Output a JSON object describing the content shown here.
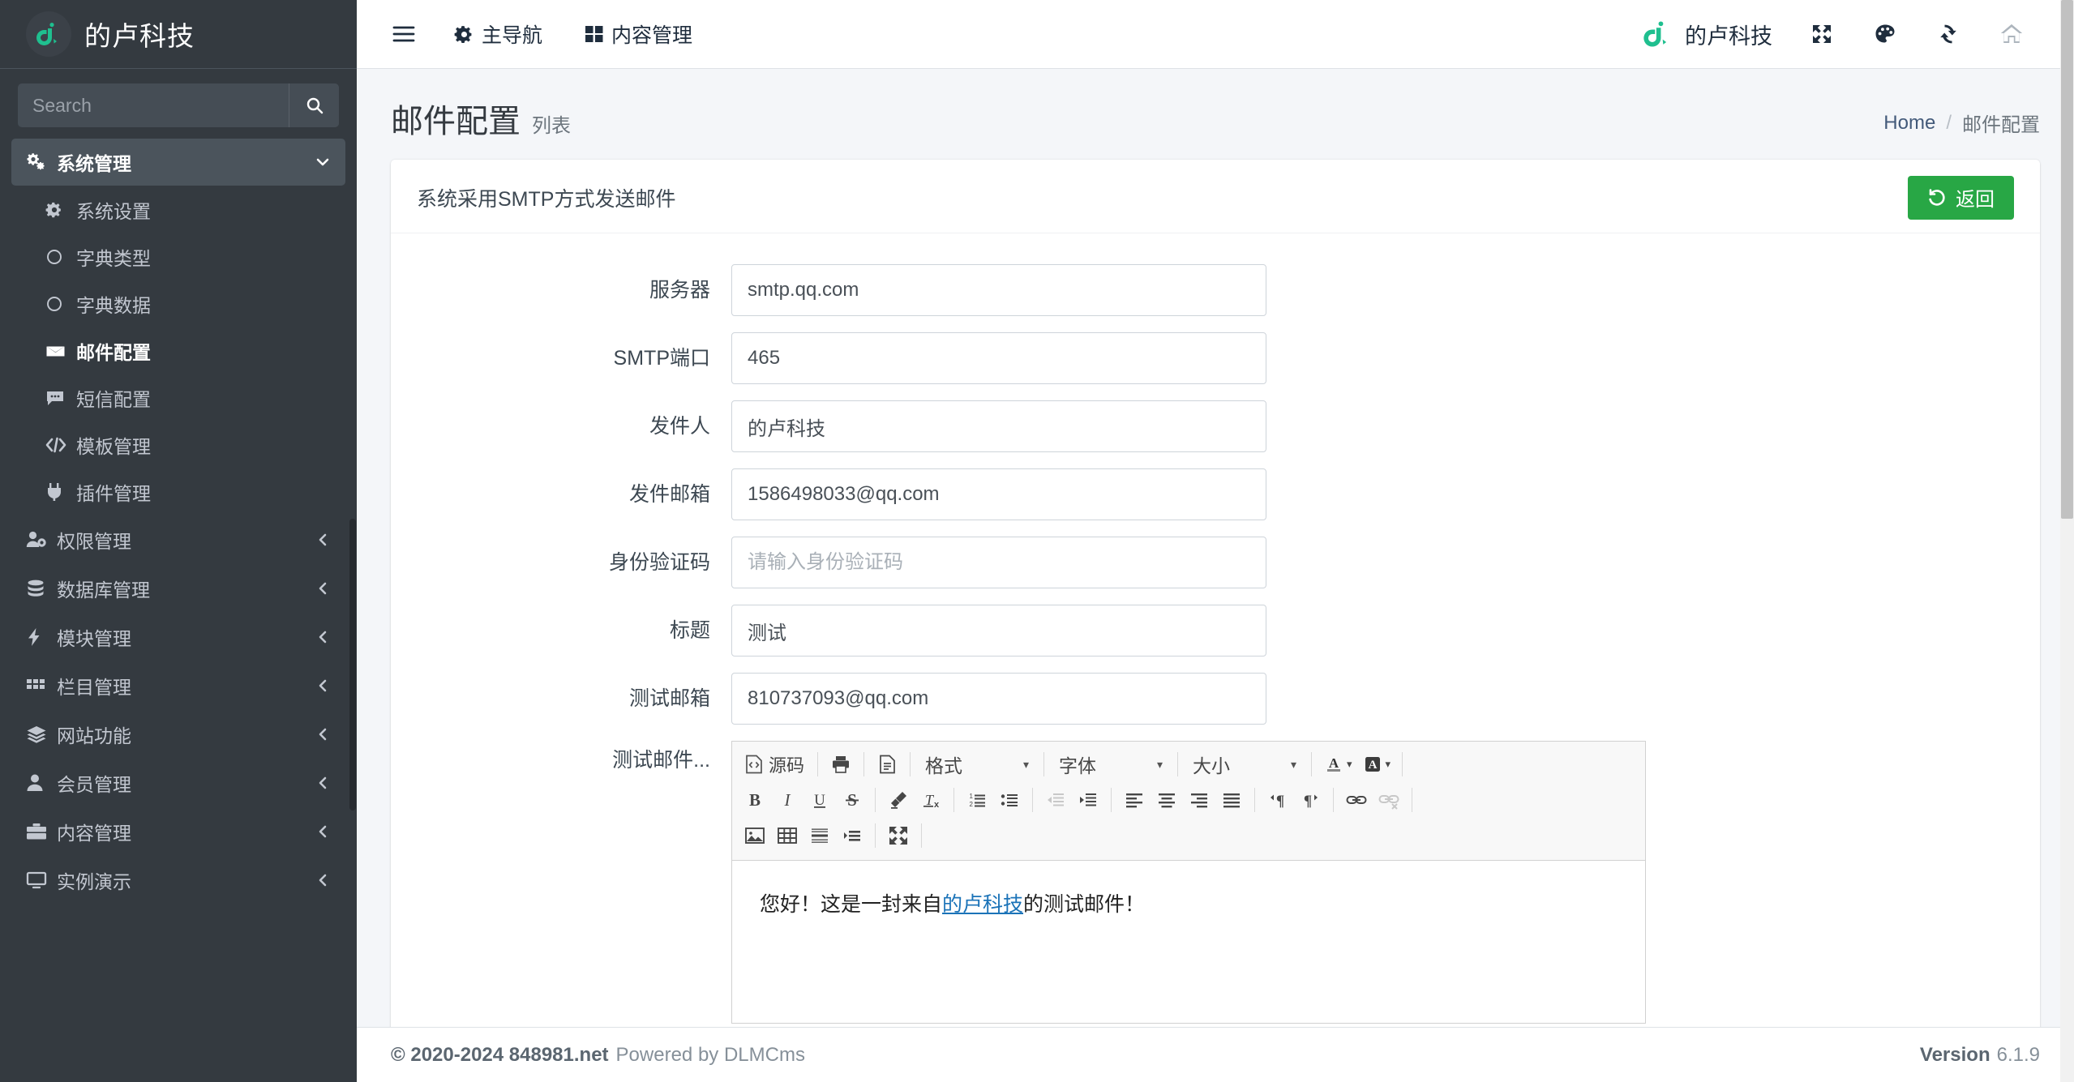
{
  "sidebar": {
    "brand": {
      "text": "的卢科技",
      "logo_icon": "dlu-logo-icon"
    },
    "search": {
      "placeholder": "Search",
      "value": "",
      "button_icon": "search-icon"
    },
    "group": {
      "label": "系统管理",
      "icon": "cogs-icon",
      "arrow_icon": "chevron-down-icon"
    },
    "sub_items": [
      {
        "label": "系统设置",
        "icon": "gear-icon",
        "active": false
      },
      {
        "label": "字典类型",
        "icon": "circle-icon",
        "active": false
      },
      {
        "label": "字典数据",
        "icon": "circle-icon",
        "active": false
      },
      {
        "label": "邮件配置",
        "icon": "envelope-icon",
        "active": true
      },
      {
        "label": "短信配置",
        "icon": "comment-icon",
        "active": false
      },
      {
        "label": "模板管理",
        "icon": "code-icon",
        "active": false
      },
      {
        "label": "插件管理",
        "icon": "plug-icon",
        "active": false
      }
    ],
    "items": [
      {
        "label": "权限管理",
        "icon": "user-cog-icon",
        "arrow_icon": "chevron-left-icon"
      },
      {
        "label": "数据库管理",
        "icon": "database-icon",
        "arrow_icon": "chevron-left-icon"
      },
      {
        "label": "模块管理",
        "icon": "bolt-icon",
        "arrow_icon": "chevron-left-icon"
      },
      {
        "label": "栏目管理",
        "icon": "grid-icon",
        "arrow_icon": "chevron-left-icon"
      },
      {
        "label": "网站功能",
        "icon": "layers-icon",
        "arrow_icon": "chevron-left-icon"
      },
      {
        "label": "会员管理",
        "icon": "user-icon",
        "arrow_icon": "chevron-left-icon"
      },
      {
        "label": "内容管理",
        "icon": "briefcase-icon",
        "arrow_icon": "chevron-left-icon"
      },
      {
        "label": "实例演示",
        "icon": "desktop-icon",
        "arrow_icon": "chevron-left-icon"
      }
    ]
  },
  "navbar": {
    "toggle_icon": "hamburger-icon",
    "links": [
      {
        "label": "主导航",
        "icon": "gear-icon"
      },
      {
        "label": "内容管理",
        "icon": "grid-icon"
      }
    ],
    "brand_mini": {
      "label": "的卢科技",
      "icon": "dlu-logo-icon"
    },
    "icons": [
      {
        "name": "expand-arrows-icon"
      },
      {
        "name": "palette-icon"
      },
      {
        "name": "refresh-icon"
      },
      {
        "name": "home-icon"
      }
    ]
  },
  "page_header": {
    "title": "邮件配置",
    "subtitle": "列表",
    "breadcrumb": {
      "home": "Home",
      "separator": "/",
      "current": "邮件配置"
    }
  },
  "card": {
    "title": "系统采用SMTP方式发送邮件",
    "return_button": {
      "label": "返回",
      "icon": "undo-icon",
      "color": "#28a745"
    }
  },
  "form": {
    "fields": [
      {
        "label": "服务器",
        "value": "smtp.qq.com",
        "placeholder": "",
        "name": "server"
      },
      {
        "label": "SMTP端口",
        "value": "465",
        "placeholder": "",
        "name": "smtp-port"
      },
      {
        "label": "发件人",
        "value": "的卢科技",
        "placeholder": "",
        "name": "sender-name"
      },
      {
        "label": "发件邮箱",
        "value": "1586498033@qq.com",
        "placeholder": "",
        "name": "sender-email"
      },
      {
        "label": "身份验证码",
        "value": "",
        "placeholder": "请输入身份验证码",
        "name": "auth-code"
      },
      {
        "label": "标题",
        "value": "测试",
        "placeholder": "",
        "name": "title"
      },
      {
        "label": "测试邮箱",
        "value": "810737093@qq.com",
        "placeholder": "",
        "name": "test-email"
      }
    ],
    "editor": {
      "label": "测试邮件...",
      "toolbar_row1": [
        {
          "type": "text",
          "label": "源码",
          "icon": "source-icon",
          "name": "source"
        },
        {
          "type": "sep"
        },
        {
          "type": "icon",
          "icon": "print-icon",
          "name": "print"
        },
        {
          "type": "sep"
        },
        {
          "type": "icon",
          "icon": "templates-icon",
          "name": "templates"
        },
        {
          "type": "sep"
        },
        {
          "type": "combo",
          "label": "格式",
          "name": "format"
        },
        {
          "type": "sep"
        },
        {
          "type": "combo",
          "label": "字体",
          "name": "font"
        },
        {
          "type": "sep"
        },
        {
          "type": "combo",
          "label": "大小",
          "name": "size"
        },
        {
          "type": "sep"
        },
        {
          "type": "icon-caret",
          "icon": "text-color-icon",
          "name": "text-color"
        },
        {
          "type": "icon-caret",
          "icon": "bg-color-icon",
          "name": "bg-color"
        },
        {
          "type": "sep"
        }
      ],
      "toolbar_row2": [
        {
          "type": "icon",
          "icon": "bold-icon",
          "name": "bold"
        },
        {
          "type": "icon",
          "icon": "italic-icon",
          "name": "italic"
        },
        {
          "type": "icon",
          "icon": "underline-icon",
          "name": "underline"
        },
        {
          "type": "icon",
          "icon": "strikethrough-icon",
          "name": "strikethrough"
        },
        {
          "type": "sep"
        },
        {
          "type": "icon",
          "icon": "remove-format-icon",
          "name": "remove-format"
        },
        {
          "type": "icon",
          "icon": "clear-formatting-icon",
          "name": "clear-formatting"
        },
        {
          "type": "sep"
        },
        {
          "type": "icon",
          "icon": "numbered-list-icon",
          "name": "numbered-list"
        },
        {
          "type": "icon",
          "icon": "bulleted-list-icon",
          "name": "bulleted-list"
        },
        {
          "type": "sep"
        },
        {
          "type": "icon",
          "icon": "outdent-icon",
          "name": "outdent",
          "disabled": true
        },
        {
          "type": "icon",
          "icon": "indent-icon",
          "name": "indent"
        },
        {
          "type": "sep"
        },
        {
          "type": "icon",
          "icon": "align-left-icon",
          "name": "align-left"
        },
        {
          "type": "icon",
          "icon": "align-center-icon",
          "name": "align-center"
        },
        {
          "type": "icon",
          "icon": "align-right-icon",
          "name": "align-right"
        },
        {
          "type": "icon",
          "icon": "align-justify-icon",
          "name": "align-justify"
        },
        {
          "type": "sep"
        },
        {
          "type": "icon",
          "icon": "ltr-icon",
          "name": "ltr"
        },
        {
          "type": "icon",
          "icon": "rtl-icon",
          "name": "rtl"
        },
        {
          "type": "sep"
        },
        {
          "type": "icon",
          "icon": "link-icon",
          "name": "link"
        },
        {
          "type": "icon",
          "icon": "unlink-icon",
          "name": "unlink",
          "disabled": true
        },
        {
          "type": "sep"
        }
      ],
      "toolbar_row3": [
        {
          "type": "icon",
          "icon": "image-icon",
          "name": "image"
        },
        {
          "type": "icon",
          "icon": "table-icon",
          "name": "table"
        },
        {
          "type": "icon",
          "icon": "horizontal-rule-icon",
          "name": "horizontal-rule"
        },
        {
          "type": "icon",
          "icon": "page-break-icon",
          "name": "page-break"
        },
        {
          "type": "sep"
        },
        {
          "type": "icon",
          "icon": "maximize-icon",
          "name": "maximize"
        },
        {
          "type": "sep"
        }
      ],
      "content": {
        "before_link": "您好！这是一封来自",
        "link_text": "的卢科技",
        "after_link": "的测试邮件！"
      }
    }
  },
  "footer": {
    "copyright_strong": "© 2020-2024 848981.net",
    "copyright_rest": "Powered by DLMCms",
    "version_label": "Version",
    "version_value": "6.1.9"
  },
  "colors": {
    "sidebar_bg": "#343a40",
    "sidebar_active": "#4b545c",
    "brand_green": "#1fbf8f",
    "success": "#28a745",
    "content_bg": "#f4f6f9"
  }
}
